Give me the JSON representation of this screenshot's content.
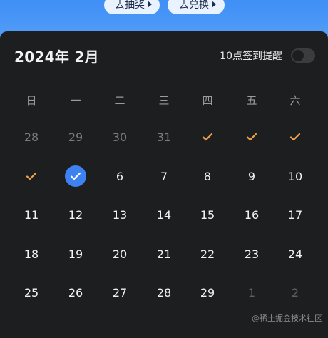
{
  "top_actions": {
    "draw_label": "去抽奖",
    "exchange_label": "去兑换"
  },
  "calendar": {
    "title": "2024年 2月",
    "reminder_label": "10点签到提醒",
    "reminder_on": false,
    "weekdays": [
      "日",
      "一",
      "二",
      "三",
      "四",
      "五",
      "六"
    ],
    "weeks": [
      [
        {
          "label": "28",
          "state": "other"
        },
        {
          "label": "29",
          "state": "other"
        },
        {
          "label": "30",
          "state": "other"
        },
        {
          "label": "31",
          "state": "other"
        },
        {
          "label": "",
          "state": "checked"
        },
        {
          "label": "",
          "state": "checked"
        },
        {
          "label": "",
          "state": "checked"
        }
      ],
      [
        {
          "label": "",
          "state": "checked"
        },
        {
          "label": "",
          "state": "today-checked"
        },
        {
          "label": "6",
          "state": "normal"
        },
        {
          "label": "7",
          "state": "normal"
        },
        {
          "label": "8",
          "state": "normal"
        },
        {
          "label": "9",
          "state": "normal"
        },
        {
          "label": "10",
          "state": "normal"
        }
      ],
      [
        {
          "label": "11",
          "state": "normal"
        },
        {
          "label": "12",
          "state": "normal"
        },
        {
          "label": "13",
          "state": "normal"
        },
        {
          "label": "14",
          "state": "normal"
        },
        {
          "label": "15",
          "state": "normal"
        },
        {
          "label": "16",
          "state": "normal"
        },
        {
          "label": "17",
          "state": "normal"
        }
      ],
      [
        {
          "label": "18",
          "state": "normal"
        },
        {
          "label": "19",
          "state": "normal"
        },
        {
          "label": "20",
          "state": "normal"
        },
        {
          "label": "21",
          "state": "normal"
        },
        {
          "label": "22",
          "state": "normal"
        },
        {
          "label": "23",
          "state": "normal"
        },
        {
          "label": "24",
          "state": "normal"
        }
      ],
      [
        {
          "label": "25",
          "state": "normal"
        },
        {
          "label": "26",
          "state": "normal"
        },
        {
          "label": "27",
          "state": "normal"
        },
        {
          "label": "28",
          "state": "normal"
        },
        {
          "label": "29",
          "state": "normal"
        },
        {
          "label": "1",
          "state": "faint"
        },
        {
          "label": "2",
          "state": "faint"
        }
      ]
    ]
  },
  "colors": {
    "check": "#f0a04a",
    "today": "#3d82f0"
  },
  "watermark": "@稀土掘金技术社区"
}
